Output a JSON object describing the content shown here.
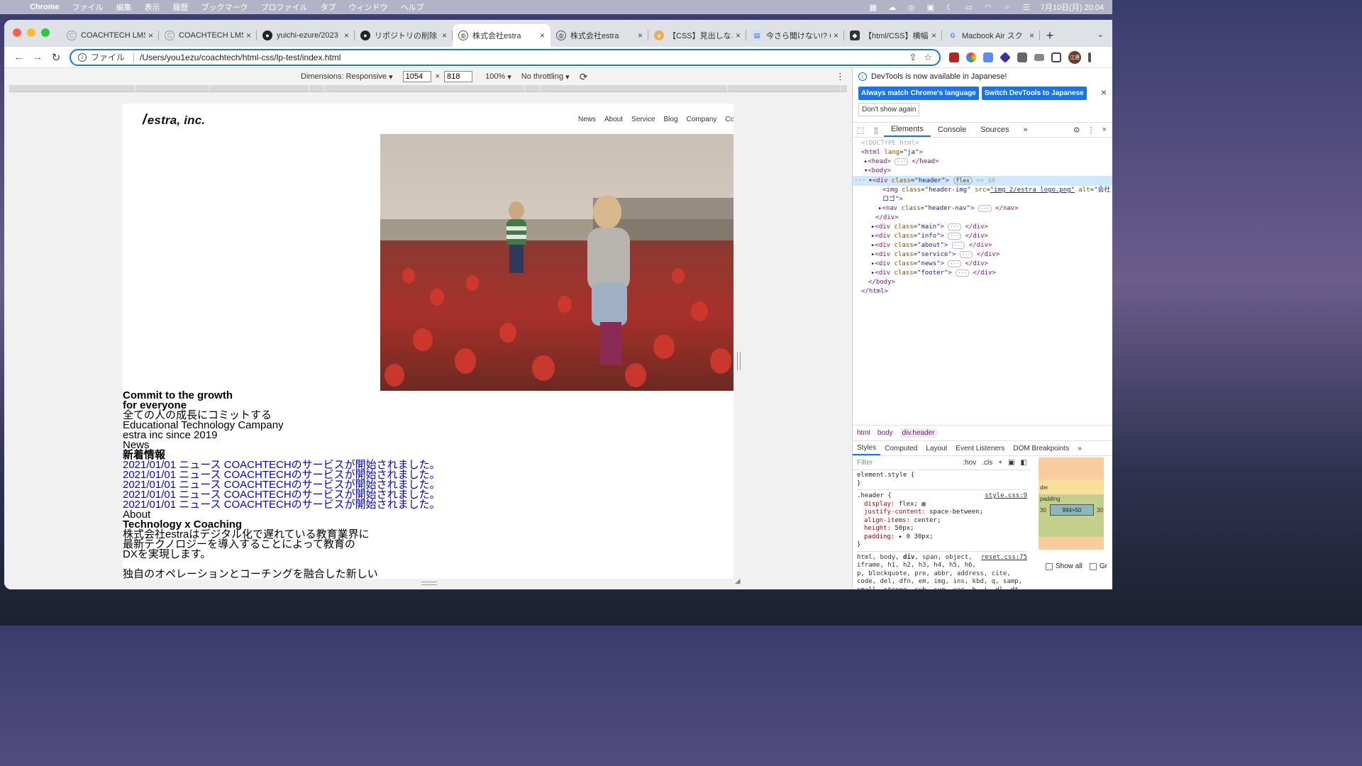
{
  "menubar": {
    "items": [
      "Chrome",
      "ファイル",
      "編集",
      "表示",
      "履歴",
      "ブックマーク",
      "プロファイル",
      "タブ",
      "ウィンドウ",
      "ヘルプ"
    ],
    "clock": "7月10日(月)  20:04"
  },
  "tabs": [
    {
      "title": "COACHTECH LMS",
      "icon": "coachtech-icon",
      "active": false
    },
    {
      "title": "COACHTECH LMS",
      "icon": "coachtech-icon",
      "active": false
    },
    {
      "title": "yuichi-ezure/2023",
      "icon": "github-icon",
      "active": false
    },
    {
      "title": "リポジトリの削除 - G",
      "icon": "github-icon",
      "active": false
    },
    {
      "title": "株式会社estra",
      "icon": "globe-icon",
      "active": true
    },
    {
      "title": "株式会社estra",
      "icon": "globe-icon",
      "active": false
    },
    {
      "title": "【CSS】見出しなど",
      "icon": "blog-icon",
      "active": false
    },
    {
      "title": "今さら聞けない!? CS",
      "icon": "doc-icon",
      "active": false
    },
    {
      "title": "【html/CSS】横幅",
      "icon": "site-icon",
      "active": false
    },
    {
      "title": "Macbook Air スク",
      "icon": "google-icon",
      "active": false
    }
  ],
  "address": {
    "scheme": "ファイル",
    "url": "/Users/you1ezu/coachtech/html-css/lp-test/index.html"
  },
  "profile": {
    "initials": "江連"
  },
  "device_toolbar": {
    "dimensions_label": "Dimensions: Responsive",
    "width": "1054",
    "height": "818",
    "zoom": "100%",
    "throttling": "No throttling"
  },
  "site": {
    "logo": "estra, inc.",
    "nav": [
      "News",
      "About",
      "Service",
      "Blog",
      "Company",
      "Co"
    ],
    "lines": [
      {
        "text": "Commit to the growth",
        "style": "b"
      },
      {
        "text": "for everyone",
        "style": "b"
      },
      {
        "text": "全ての人の成長にコミットする",
        "style": ""
      },
      {
        "text": "Educational Technology Campany",
        "style": ""
      },
      {
        "text": "estra inc since 2019",
        "style": ""
      },
      {
        "text": "News",
        "style": ""
      },
      {
        "text": "新着情報",
        "style": "b"
      },
      {
        "text": "2021/01/01 ニュース COACHTECHのサービスが開始されました。",
        "style": "link"
      },
      {
        "text": "2021/01/01 ニュース COACHTECHのサービスが開始されました。",
        "style": "link"
      },
      {
        "text": "2021/01/01 ニュース COACHTECHのサービスが開始されました。",
        "style": "link"
      },
      {
        "text": "2021/01/01 ニュース COACHTECHのサービスが開始されました。",
        "style": "link"
      },
      {
        "text": "2021/01/01 ニュース COACHTECHのサービスが開始されました。",
        "style": "link"
      },
      {
        "text": "About",
        "style": ""
      },
      {
        "text": "Technology x Coaching",
        "style": "b"
      },
      {
        "text": "株式会社estraはデジタル化で遅れている教育業界に",
        "style": ""
      },
      {
        "text": "最新テクノロジーを導入することによって教育の",
        "style": ""
      },
      {
        "text": "DXを実現します。",
        "style": ""
      },
      {
        "text": "",
        "style": "gap"
      },
      {
        "text": "独自のオペレーションとコーチングを融合した新しい",
        "style": ""
      }
    ]
  },
  "devtools": {
    "banner": "DevTools is now available in Japanese!",
    "btn_match": "Always match Chrome's language",
    "btn_switch": "Switch DevTools to Japanese",
    "btn_dont": "Don't show again",
    "tabs": [
      "Elements",
      "Console",
      "Sources"
    ],
    "breadcrumbs": [
      "html",
      "body",
      "div.header"
    ],
    "style_tabs": [
      "Styles",
      "Computed",
      "Layout",
      "Event Listeners",
      "DOM Breakpoints"
    ],
    "filter_placeholder": "Filter",
    "hov": ":hov",
    "cls": ".cls",
    "box_content": "994×50",
    "box_padding_lr": "30",
    "show_all": "Show all",
    "show_all_2": "Gr"
  }
}
